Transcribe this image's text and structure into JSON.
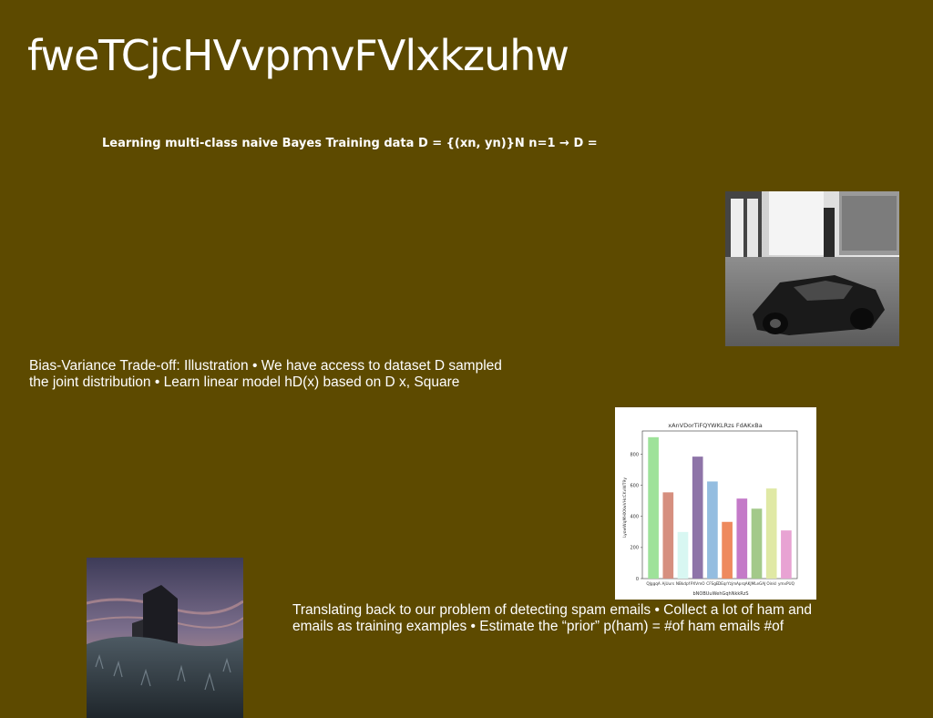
{
  "slide": {
    "title": "fweTCjcHVvpmvFVlxkzuhw",
    "subtitle": "Learning multi-class naive Bayes Training data D = {(xn, yn)}N n=1 → D =",
    "block1": {
      "line1": "Bias-Variance Trade-off: Illustration • We have access to dataset D sampled",
      "line2": "the joint distribution • Learn linear model hD(x) based on D x, Square"
    },
    "block2": {
      "line1": "Translating back to our problem of detecting spam emails • Collect a lot of ham and",
      "line2": "emails as training examples • Estimate the “prior” p(ham) = #of ham emails #of"
    }
  },
  "chart_data": {
    "type": "bar",
    "title": "xAnVDorTiFQYWKLRzs FdAKxBa",
    "xlabel": "bNOBUuWehGqhNkkRzS",
    "ylabel": "LyowWqMHXXwVHcCKvWT9y",
    "categories": [
      "QJggqA",
      "AjUurs",
      "NBkdpf",
      "PXVmO",
      "CFSgE",
      "DEqrYzjm",
      "AprqA",
      "KJMLeGAJ",
      "Oinkl",
      "ymxPUQ"
    ],
    "values": [
      910,
      555,
      300,
      785,
      625,
      365,
      515,
      450,
      580,
      310
    ],
    "colors": [
      "#9ee29a",
      "#d68f7f",
      "#d8f7f2",
      "#8e74a8",
      "#94bde0",
      "#ee8a5e",
      "#c47ac8",
      "#a3c98a",
      "#e0e9a5",
      "#e8a3d3"
    ],
    "yticks": [
      0,
      200,
      400,
      600,
      800
    ],
    "ylim": [
      0,
      950
    ]
  }
}
